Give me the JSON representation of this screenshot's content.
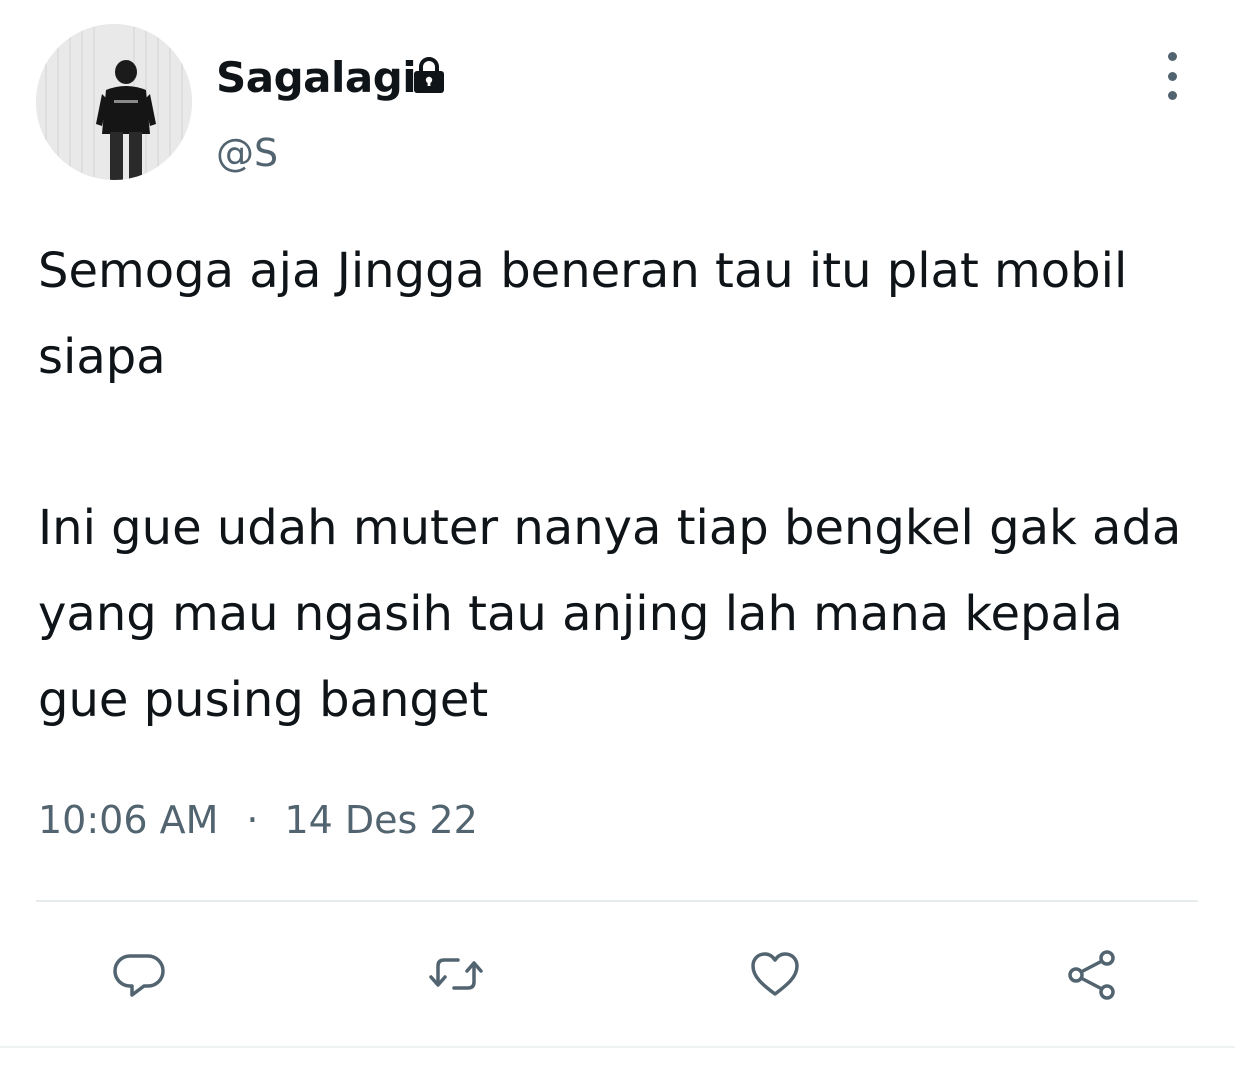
{
  "author": {
    "display_name": "Sagalagi",
    "handle": "@S",
    "avatar_icon": "profile-photo",
    "protected_icon": "lock-icon"
  },
  "tweet": {
    "paragraphs": [
      "Semoga aja Jingga beneran tau itu plat mobil siapa",
      "Ini gue udah muter nanya tiap bengkel gak ada yang mau ngasih tau anjing lah mana kepala gue pusing banget"
    ],
    "time": "10:06 AM",
    "separator": "·",
    "date": "14 Des 22"
  },
  "actions": [
    {
      "icon": "reply-icon"
    },
    {
      "icon": "retweet-icon"
    },
    {
      "icon": "like-icon"
    },
    {
      "icon": "share-icon"
    }
  ],
  "menu": {
    "icon": "more-options-icon"
  },
  "colors": {
    "text_primary": "#0f1419",
    "text_secondary": "#536471",
    "divider": "#e6ebee"
  }
}
